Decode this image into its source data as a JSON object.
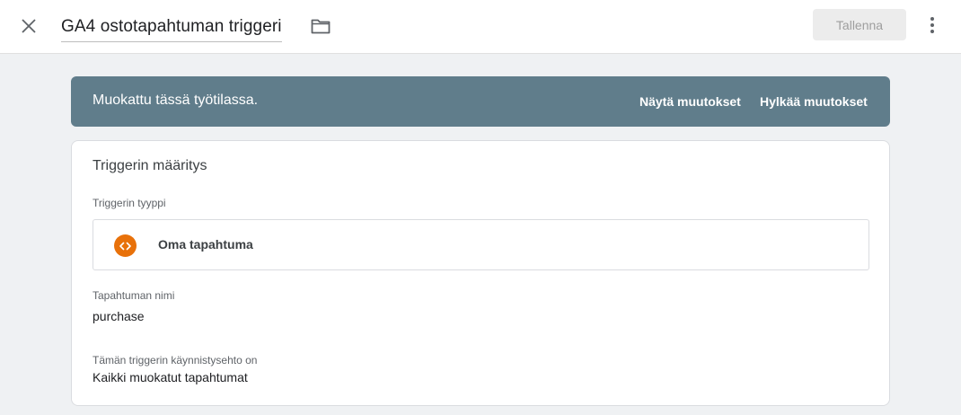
{
  "header": {
    "title": "GA4 ostotapahtuman triggeri",
    "save_label": "Tallenna",
    "close_icon": "close-icon",
    "folder_icon": "folder-icon",
    "more_icon": "more-vert-icon"
  },
  "notice": {
    "text": "Muokattu tässä työtilassa.",
    "show_changes": "Näytä muutokset",
    "discard_changes": "Hylkää muutokset",
    "background": "#607d8b"
  },
  "trigger": {
    "section_title": "Triggerin määritys",
    "type_label": "Triggerin tyyppi",
    "type_name": "Oma tapahtuma",
    "type_icon": "custom-event-icon",
    "type_icon_color": "#e8710a",
    "event_name_label": "Tapahtuman nimi",
    "event_name_value": "purchase",
    "fires_on_label": "Tämän triggerin käynnistysehto on",
    "fires_on_value": "Kaikki muokatut tapahtumat"
  }
}
